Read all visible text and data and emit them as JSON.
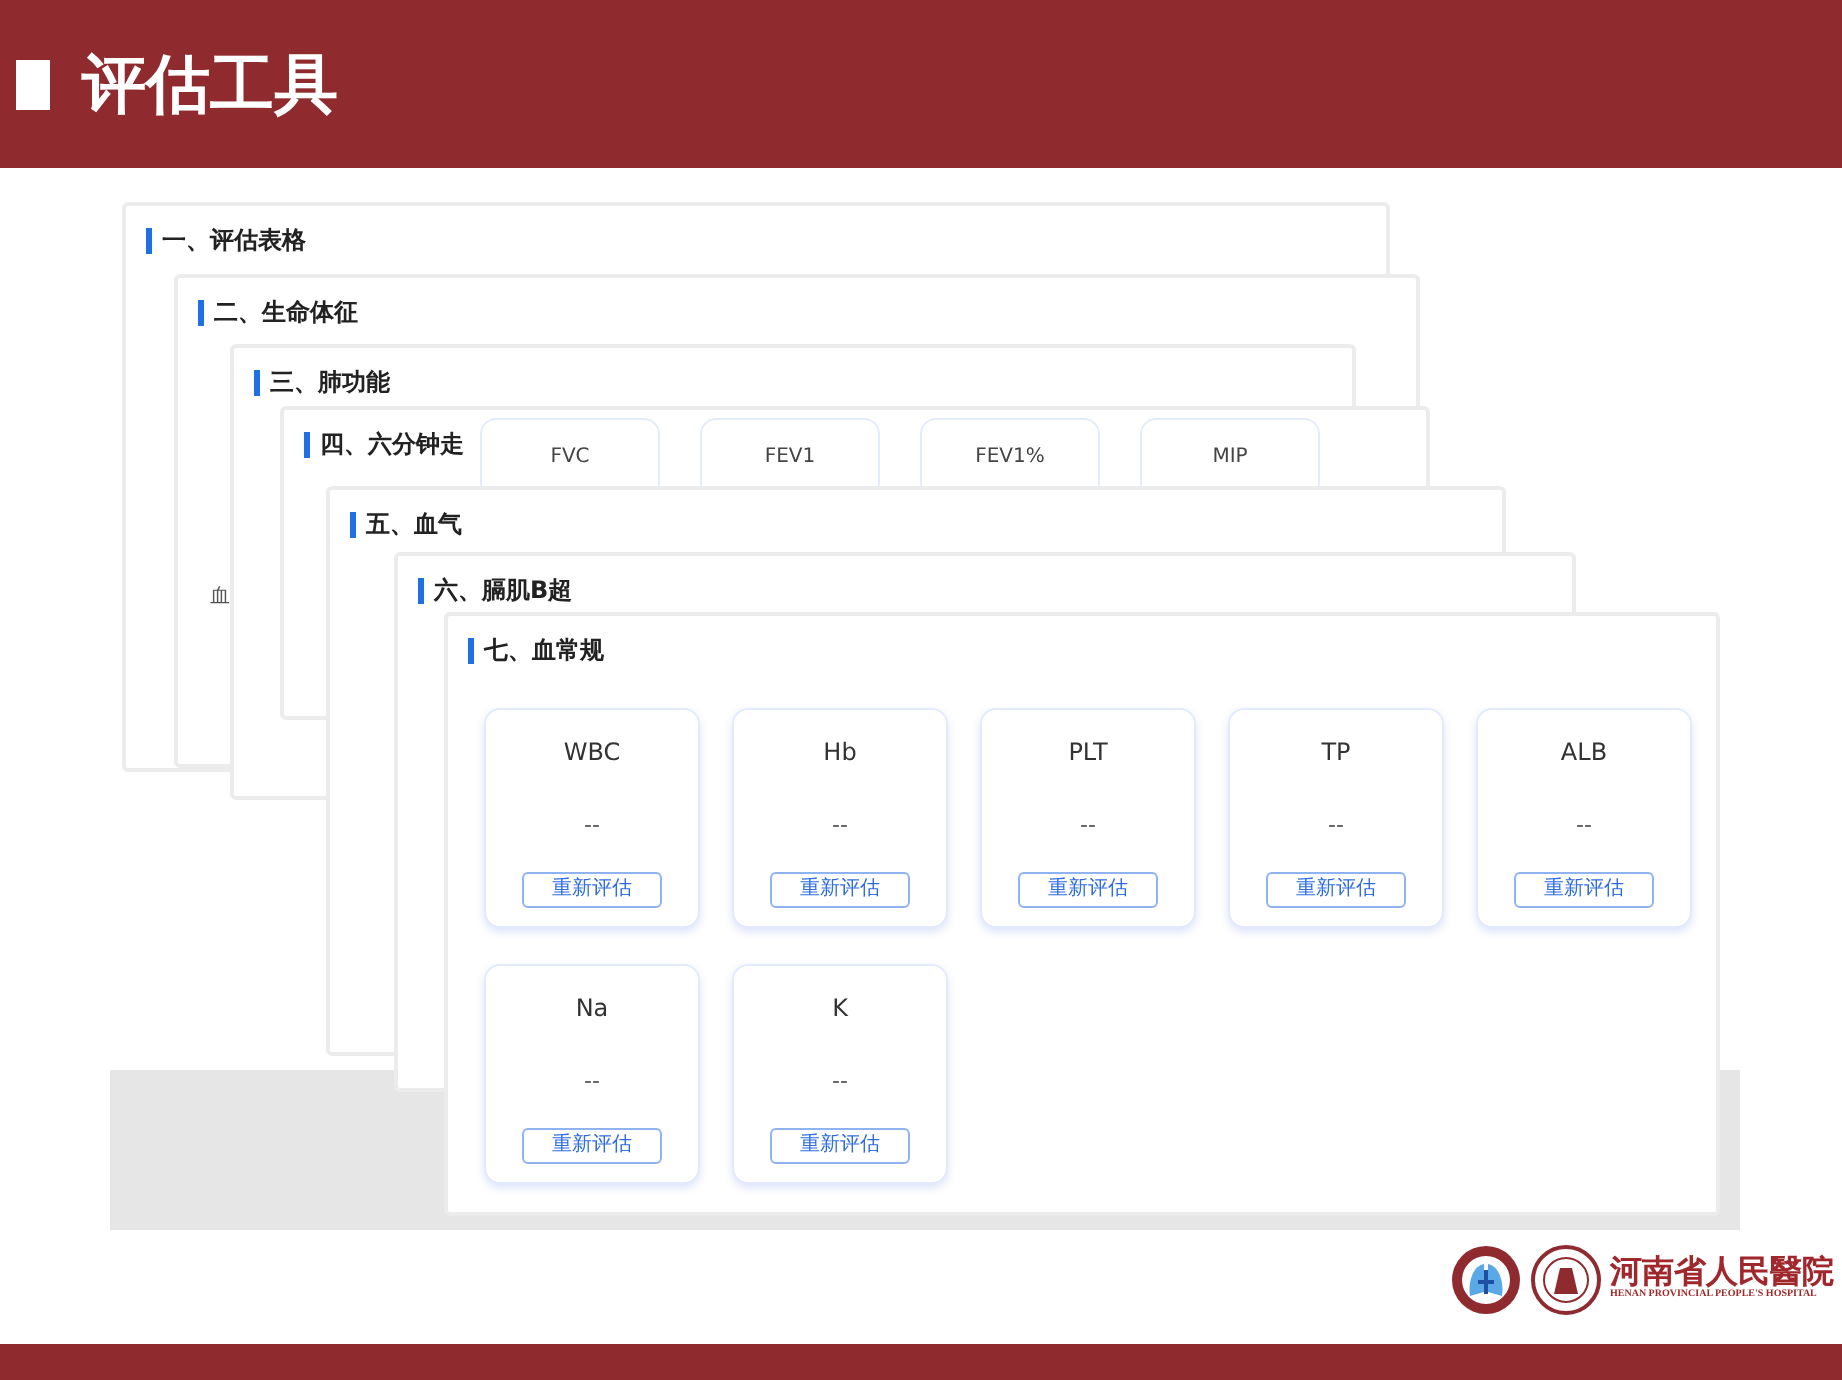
{
  "header": {
    "title": "评估工具"
  },
  "panels": [
    {
      "title": "一、评估表格"
    },
    {
      "title": "二、生命体征",
      "peek_text": "血"
    },
    {
      "title": "三、肺功能"
    },
    {
      "title": "四、六分钟走",
      "cards": [
        {
          "label": "FVC"
        },
        {
          "label": "FEV1"
        },
        {
          "label": "FEV1%"
        },
        {
          "label": "MIP"
        }
      ]
    },
    {
      "title": "五、血气"
    },
    {
      "title": "六、膈肌B超"
    },
    {
      "title": "七、血常规",
      "cards": [
        {
          "label": "WBC",
          "value": "--",
          "button": "重新评估"
        },
        {
          "label": "Hb",
          "value": "--",
          "button": "重新评估"
        },
        {
          "label": "PLT",
          "value": "--",
          "button": "重新评估"
        },
        {
          "label": "TP",
          "value": "--",
          "button": "重新评估"
        },
        {
          "label": "ALB",
          "value": "--",
          "button": "重新评估"
        },
        {
          "label": "Na",
          "value": "--",
          "button": "重新评估"
        },
        {
          "label": "K",
          "value": "--",
          "button": "重新评估"
        }
      ]
    }
  ],
  "logo": {
    "name_cn": "河南省人民醫院",
    "name_en": "HENAN PROVINCIAL PEOPLE'S HOSPITAL"
  }
}
